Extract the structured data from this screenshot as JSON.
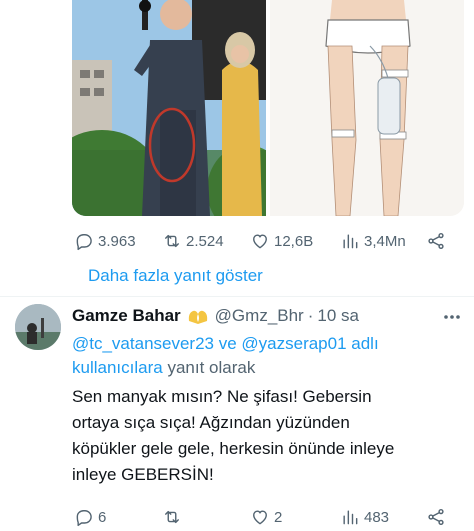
{
  "quoted_stats": {
    "replies": "3.963",
    "retweets": "2.524",
    "likes": "12,6B",
    "views": "3,4Mn"
  },
  "show_more_replies": "Daha fazla yanıt göster",
  "reply": {
    "display_name": "Gamze Bahar",
    "handle": "@Gmz_Bhr",
    "separator": "·",
    "time": "10 sa",
    "reply_mentions": "@tc_vatansever23 ve @yazserap01 adlı kullanıcılara",
    "reply_suffix": "yanıt olarak",
    "text_lines": [
      "Sen manyak mısın? Ne şifası! Gebersin",
      "ortaya sıça sıça! Ağzından yüzünden",
      "köpükler gele gele, herkesin önünde inleye",
      "inleye GEBERSİN!"
    ],
    "stats": {
      "replies": "6",
      "likes": "2",
      "views": "483"
    }
  },
  "colors": {
    "accent": "#1d9bf0",
    "text": "#0f1419",
    "muted": "#536471"
  }
}
